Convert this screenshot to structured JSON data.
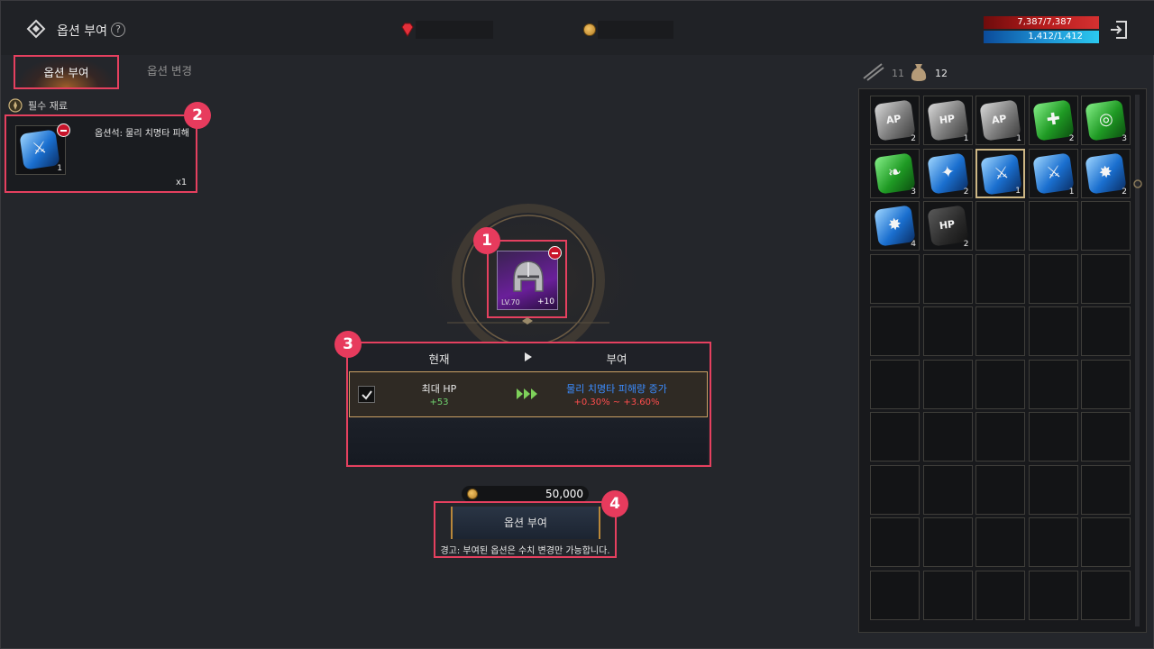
{
  "header": {
    "title": "옵션 부여",
    "help": "?",
    "hp": "7,387/7,387",
    "mp": "1,412/1,412"
  },
  "tabs": [
    {
      "label": "옵션 부여",
      "active": true
    },
    {
      "label": "옵션 변경",
      "active": false
    }
  ],
  "materials": {
    "section_label": "필수 재료",
    "item_name": "옵션석: 물리 치명타 피해",
    "item_count": "1",
    "required_qty": "x1"
  },
  "equipment": {
    "level": "LV.70",
    "enhance": "+10",
    "icon": "helmet-icon"
  },
  "options": {
    "current_header": "현재",
    "grant_header": "부여",
    "current_name": "최대 HP",
    "current_value": "+53",
    "grant_name": "물리 치명타 피해량 증가",
    "grant_range": "+0.30% ~ +3.60%"
  },
  "cost": "50,000",
  "action_button": "옵션 부여",
  "warning": "경고: 부여된 옵션은 수치 변경만 가능합니다.",
  "badges": [
    "1",
    "2",
    "3",
    "4"
  ],
  "inventory": {
    "weapon_count": "11",
    "bag_count": "12",
    "items": [
      {
        "type": "grey",
        "glyph": "AP",
        "count": "2"
      },
      {
        "type": "grey",
        "glyph": "HP",
        "count": "1"
      },
      {
        "type": "grey",
        "glyph": "AP",
        "count": "1"
      },
      {
        "type": "green",
        "glyph": "✚",
        "count": "2"
      },
      {
        "type": "green",
        "glyph": "◎",
        "count": "3"
      },
      {
        "type": "green",
        "glyph": "❧",
        "count": "3"
      },
      {
        "type": "blue",
        "glyph": "✦",
        "count": "2"
      },
      {
        "type": "blue",
        "glyph": "⚔",
        "count": "1"
      },
      {
        "type": "blue",
        "glyph": "⚔",
        "count": "1"
      },
      {
        "type": "blue",
        "glyph": "✸",
        "count": "2"
      },
      {
        "type": "blue",
        "glyph": "✸",
        "count": "4"
      },
      {
        "type": "dark",
        "glyph": "HP",
        "count": "2"
      }
    ]
  },
  "colors": {
    "highlight": "#e5405f",
    "gold": "#cdb684",
    "positive": "#6fd36f",
    "grant_blue": "#3b8cff",
    "range_red": "#ff4d4d"
  }
}
